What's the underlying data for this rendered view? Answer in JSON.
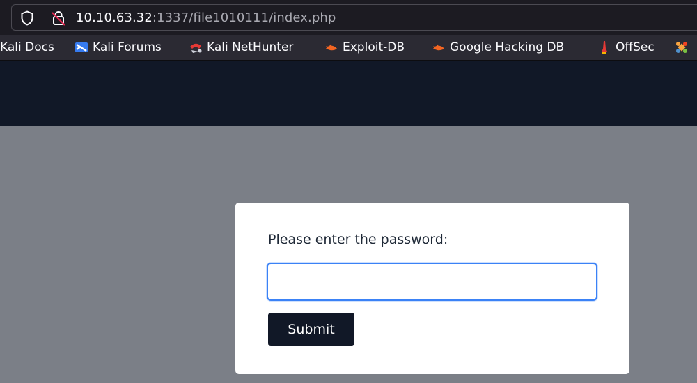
{
  "browser": {
    "url_host": "10.10.63.32",
    "url_rest": ":1337/file1010111/index.php",
    "icons": {
      "tracking": "shield-icon",
      "insecure": "insecure-lock-icon"
    }
  },
  "bookmarks": [
    {
      "label": "Kali Docs",
      "icon": "none"
    },
    {
      "label": "Kali Forums",
      "icon": "kali-forums-icon"
    },
    {
      "label": "Kali NetHunter",
      "icon": "kali-nethunter-icon"
    },
    {
      "label": "Exploit-DB",
      "icon": "exploit-db-icon"
    },
    {
      "label": "Google Hacking DB",
      "icon": "google-hacking-db-icon"
    },
    {
      "label": "OffSec",
      "icon": "offsec-icon"
    }
  ],
  "page": {
    "prompt": "Please enter the password:",
    "password_value": "",
    "submit_label": "Submit"
  },
  "colors": {
    "navbar": "#111827",
    "overlay": "#7b7f87",
    "focus_ring": "#3b82f6",
    "button": "#111827"
  }
}
